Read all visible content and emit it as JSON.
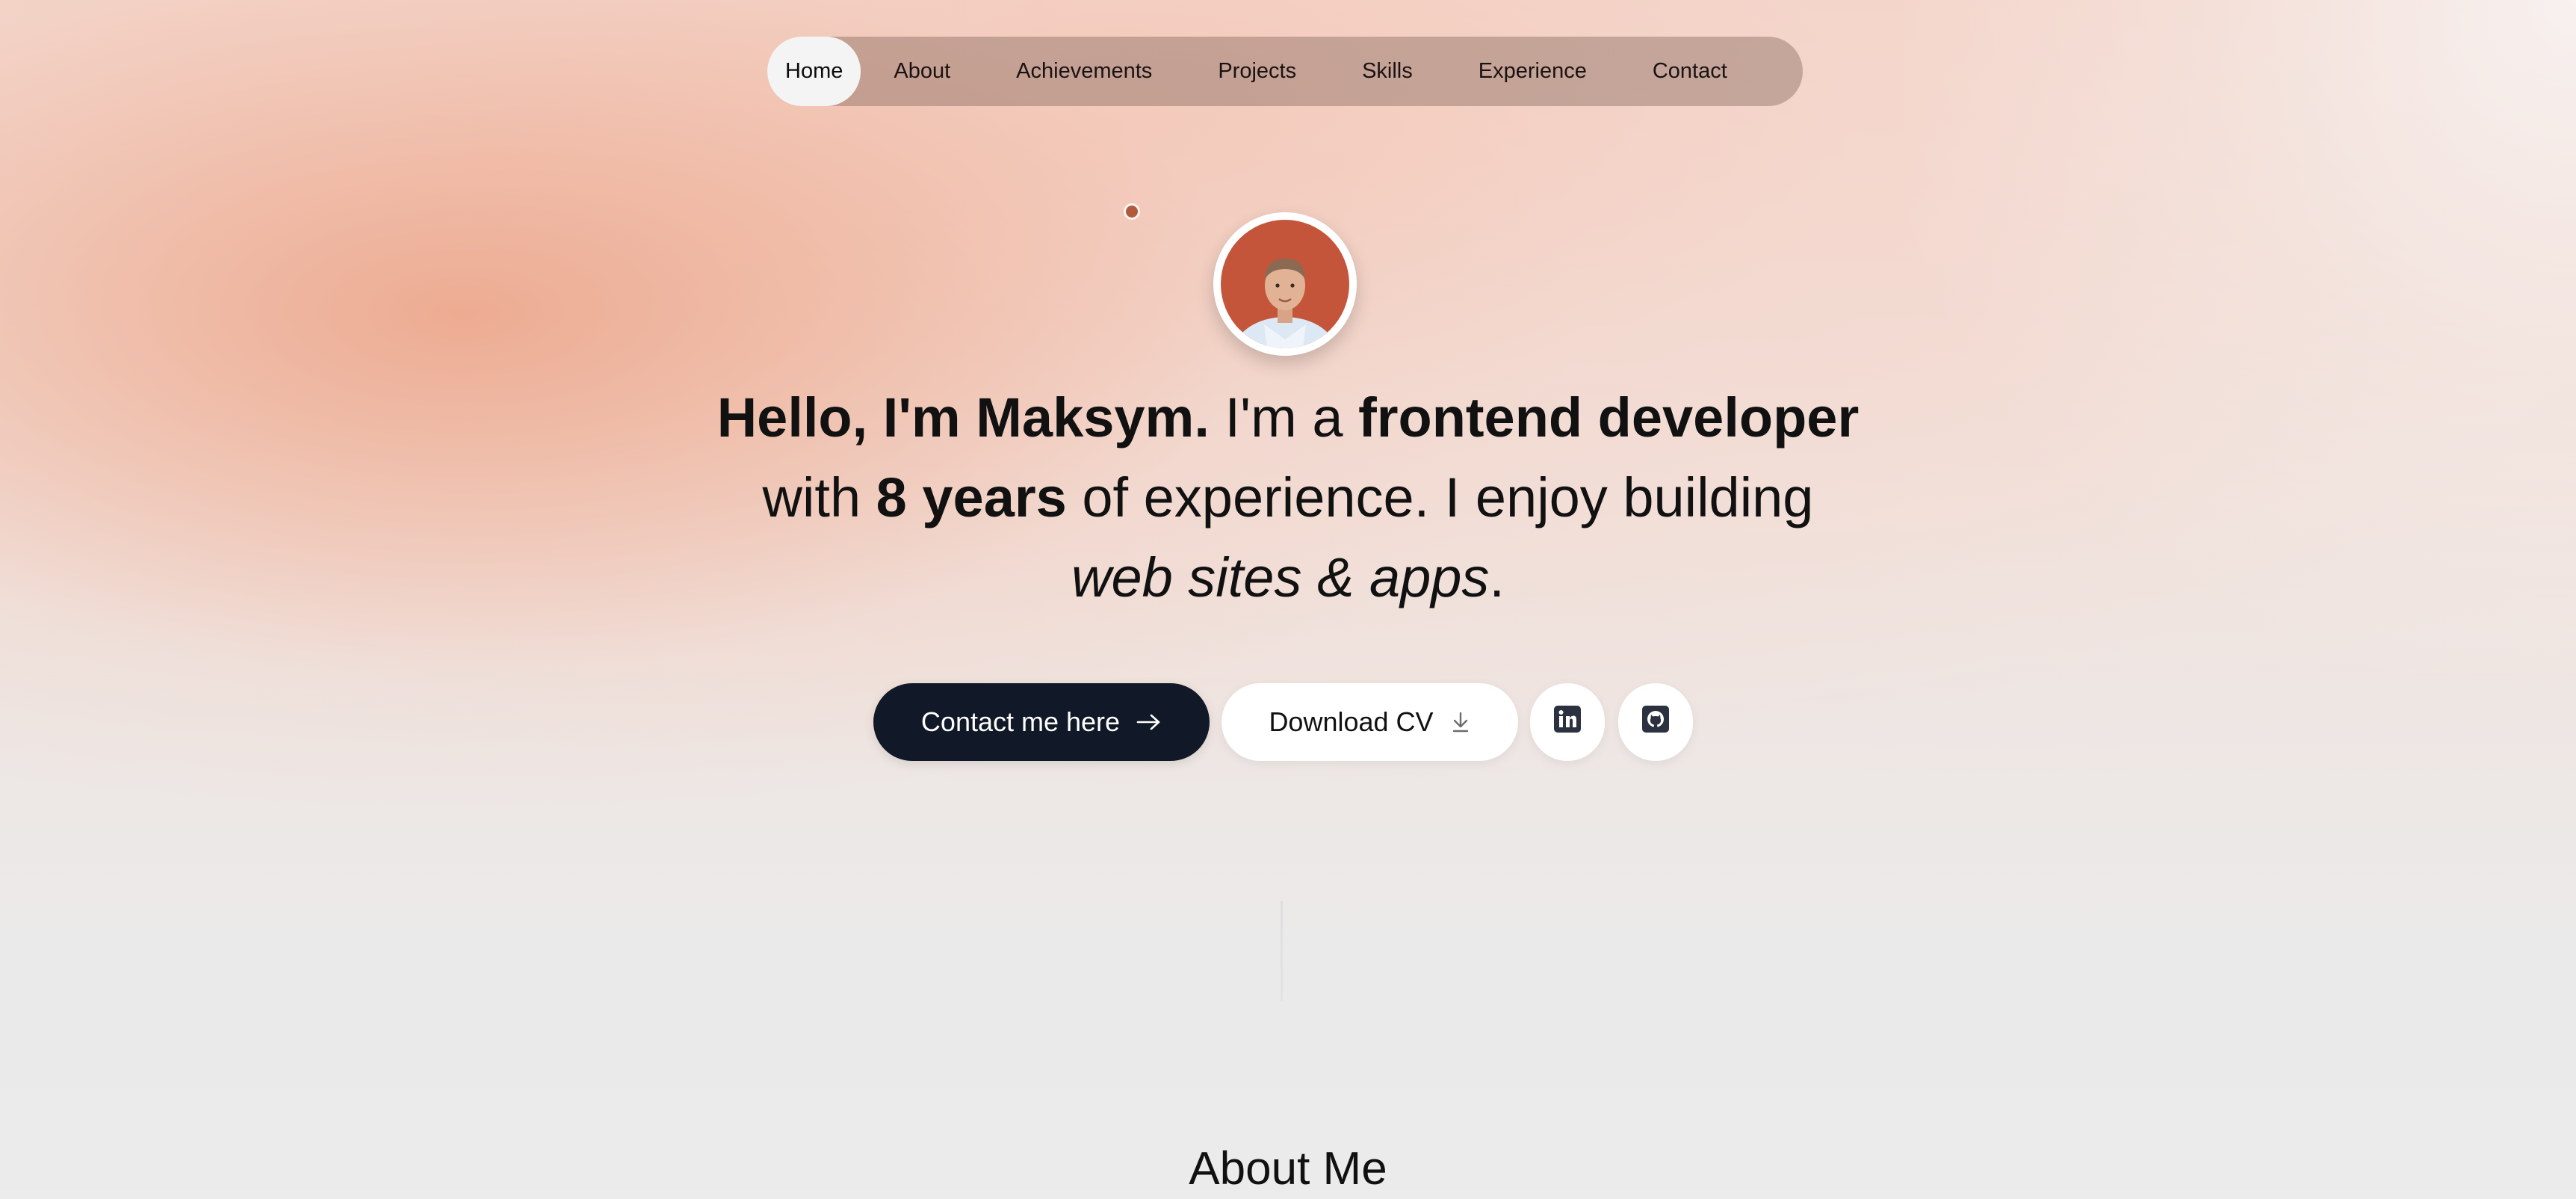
{
  "nav": {
    "items": [
      {
        "label": "Home",
        "active": true
      },
      {
        "label": "About"
      },
      {
        "label": "Achievements"
      },
      {
        "label": "Projects"
      },
      {
        "label": "Skills"
      },
      {
        "label": "Experience"
      },
      {
        "label": "Contact"
      }
    ]
  },
  "hero": {
    "greeting": "Hello, I'm Maksym.",
    "part2": " I'm a ",
    "role": "frontend developer",
    "part3": "with ",
    "years": "8 years",
    "part4": " of experience. I enjoy building",
    "focus": "web sites & apps",
    "period": "."
  },
  "actions": {
    "contact_label": "Contact me here",
    "contact_icon": "arrow-right-icon",
    "cv_label": "Download CV",
    "cv_icon": "download-icon",
    "linkedin_icon": "linkedin-icon",
    "github_icon": "github-icon"
  },
  "about": {
    "title": "About Me"
  },
  "colors": {
    "dark_button": "#111827",
    "accent_peach": "#eaa68c",
    "avatar_bg": "#c4553a"
  }
}
